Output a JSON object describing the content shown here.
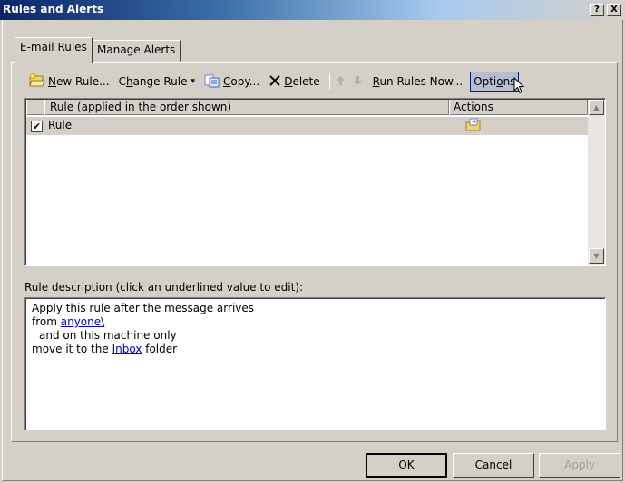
{
  "window": {
    "title": "Rules and Alerts",
    "help_btn": "?",
    "close_btn": "X"
  },
  "tabs": [
    {
      "label": "E-mail Rules",
      "active": true
    },
    {
      "label": "Manage Alerts",
      "active": false
    }
  ],
  "toolbar": {
    "new_rule": {
      "ul": "N",
      "rest": "ew Rule..."
    },
    "change_rule": {
      "pre": "C",
      "ul": "h",
      "rest": "ange Rule",
      "arrow": "▾"
    },
    "copy": {
      "ul": "C",
      "rest": "opy..."
    },
    "delete": {
      "ul": "D",
      "rest": "elete"
    },
    "run_rules": {
      "ul": "R",
      "rest": "un Rules Now..."
    },
    "options": {
      "pre": "Opti",
      "ul": "o",
      "rest": "ns"
    }
  },
  "rules_list": {
    "columns": [
      "Rule (applied in the order shown)",
      "Actions"
    ],
    "rows": [
      {
        "checked": true,
        "check_mark": "✔",
        "name": "Rule"
      }
    ]
  },
  "description": {
    "label": "Rule description (click an underlined value to edit):",
    "line1": "Apply this rule after the message arrives",
    "line2_pre": "from ",
    "line2_link": "anyone\\",
    "line3": "and on this machine only",
    "line4_pre": "move it to the ",
    "line4_link": "Inbox",
    "line4_post": " folder"
  },
  "buttons": {
    "ok": "OK",
    "cancel": "Cancel",
    "apply": "Apply"
  },
  "icons": {
    "new_rule": "new-rule-icon",
    "copy": "copy-icon",
    "delete": "delete-x-icon",
    "move_up": "up-arrow-icon",
    "move_down": "down-arrow-icon",
    "action": "move-to-folder-icon"
  }
}
